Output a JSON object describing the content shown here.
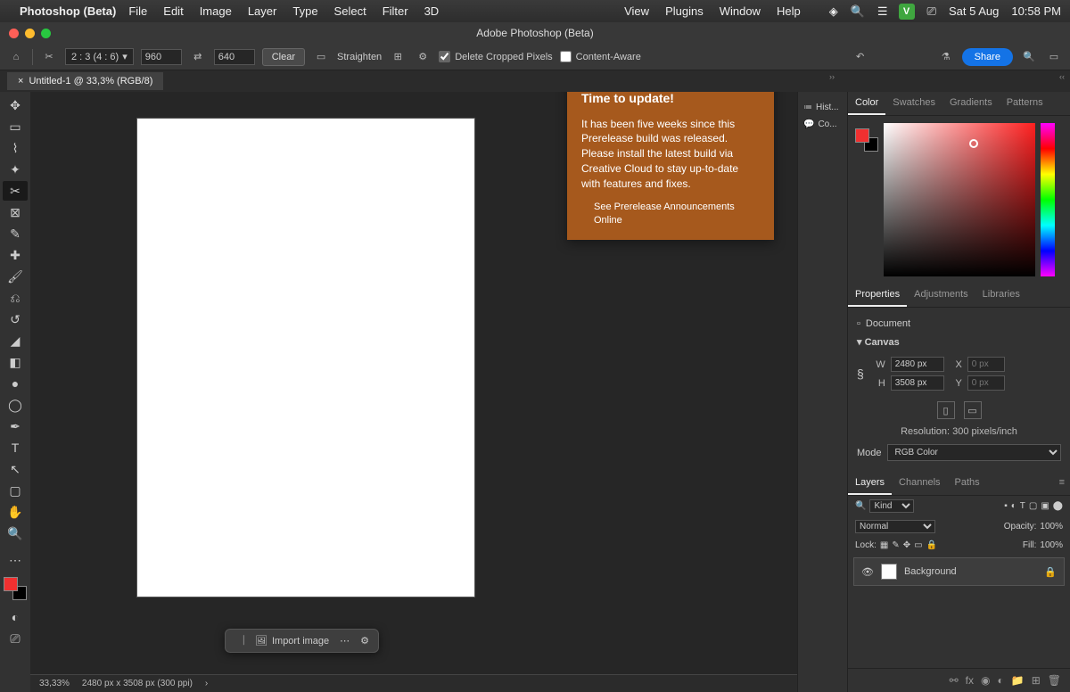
{
  "menubar": {
    "app": "Photoshop (Beta)",
    "items": [
      "File",
      "Edit",
      "Image",
      "Layer",
      "Type",
      "Select",
      "Filter",
      "3D"
    ],
    "right_items": [
      "View",
      "Plugins",
      "Window",
      "Help"
    ],
    "date": "Sat 5 Aug",
    "time": "10:58 PM"
  },
  "titlebar": {
    "title": "Adobe Photoshop (Beta)"
  },
  "options": {
    "ratio": "2 : 3 (4 : 6)",
    "w": "960",
    "h": "640",
    "clear": "Clear",
    "straighten": "Straighten",
    "delcropped": "Delete Cropped Pixels",
    "contentaware": "Content-Aware",
    "share": "Share"
  },
  "tab": {
    "label": "Untitled-1 @ 33,3% (RGB/8)"
  },
  "contextbar": {
    "import": "Import image"
  },
  "status": {
    "zoom": "33,33%",
    "dims": "2480 px x 3508 px (300 ppi)"
  },
  "midpanels": {
    "a": "Hist...",
    "b": "Co..."
  },
  "colorpanel": {
    "tabs": [
      "Color",
      "Swatches",
      "Gradients",
      "Patterns"
    ]
  },
  "props": {
    "tabs": [
      "Properties",
      "Adjustments",
      "Libraries"
    ],
    "doclabel": "Document",
    "canvas": "Canvas",
    "w": "2480 px",
    "h": "3508 px",
    "x": "0 px",
    "y": "0 px",
    "W": "W",
    "H": "H",
    "X": "X",
    "Y": "Y",
    "res": "Resolution: 300 pixels/inch",
    "modelabel": "Mode",
    "mode": "RGB Color"
  },
  "layers": {
    "tabs": [
      "Layers",
      "Channels",
      "Paths"
    ],
    "kind": "Kind",
    "blend": "Normal",
    "opacitylbl": "Opacity:",
    "opacity": "100%",
    "locklbl": "Lock:",
    "filllbl": "Fill:",
    "fill": "100%",
    "bgname": "Background"
  },
  "notice": {
    "title": "Time to update!",
    "body": "It has been five weeks since this Prerelease build was released. Please install the latest build via Creative Cloud to stay up-to-date with features and fixes.",
    "link": "See Prerelease Announcements Online"
  }
}
